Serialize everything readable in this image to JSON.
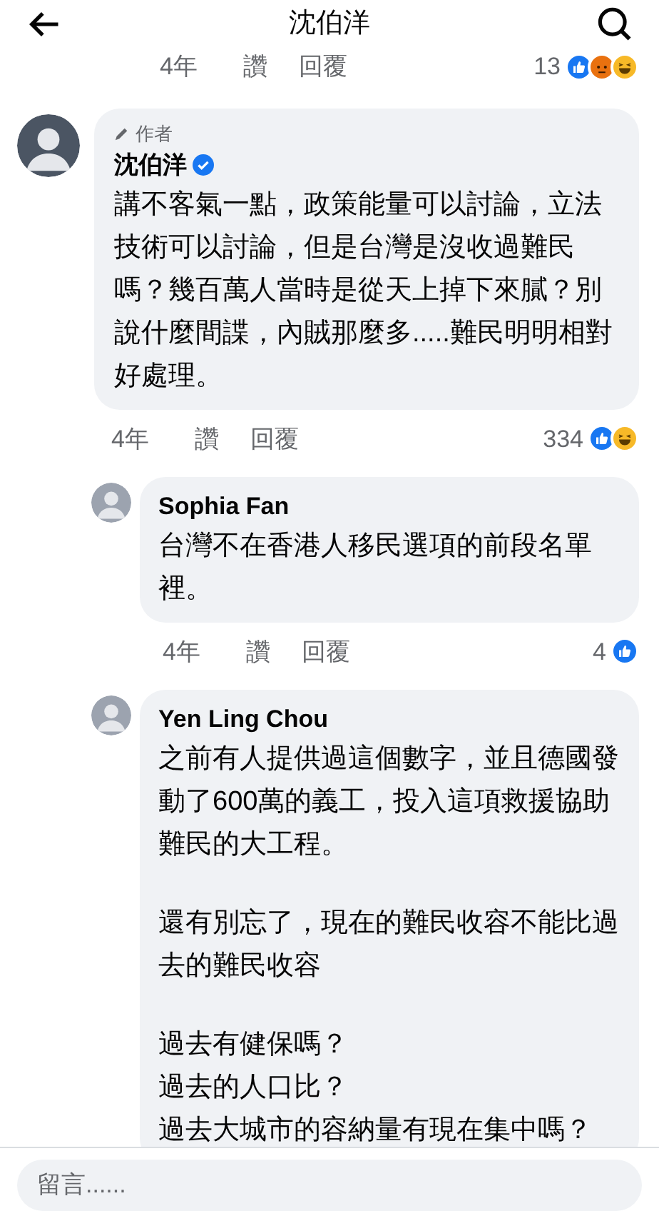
{
  "header": {
    "title": "沈伯洋"
  },
  "top_actions": {
    "time": "4年",
    "like": "讚",
    "reply": "回覆",
    "reaction_count": "13",
    "reactions": [
      {
        "kind": "like"
      },
      {
        "kind": "angry"
      },
      {
        "kind": "haha"
      }
    ]
  },
  "comments": [
    {
      "author": "沈伯洋",
      "badge": "作者",
      "verified": true,
      "paragraphs": [
        [
          "講不客氣一點，政策能量可以討論，立法技術可以討論，但是台灣是沒收過難民嗎？幾百萬人當時是從天上掉下來膩？別說什麼間諜，內賊那麼多.....難民明明相對好處理。"
        ]
      ],
      "time": "4年",
      "like": "讚",
      "reply": "回覆",
      "reaction_count": "334",
      "reactions": [
        {
          "kind": "like"
        },
        {
          "kind": "haha"
        }
      ],
      "replies": [
        {
          "author": "Sophia Fan",
          "verified": false,
          "paragraphs": [
            [
              "台灣不在香港人移民選項的前段名單裡。"
            ]
          ],
          "time": "4年",
          "like": "讚",
          "reply": "回覆",
          "reaction_count": "4",
          "reactions": [
            {
              "kind": "like"
            }
          ]
        },
        {
          "author": "Yen Ling Chou",
          "verified": false,
          "paragraphs": [
            [
              "之前有人提供過這個數字，並且德國發動了600萬的義工，投入這項救援協助難民的大工程。"
            ],
            [
              "還有別忘了，現在的難民收容不能比過去的難民收容"
            ],
            [
              "過去有健保嗎？",
              "過去的人口比？",
              "過去大城市的容納量有現在集中嗎？"
            ]
          ]
        }
      ]
    }
  ],
  "composer": {
    "placeholder": "留言......"
  }
}
